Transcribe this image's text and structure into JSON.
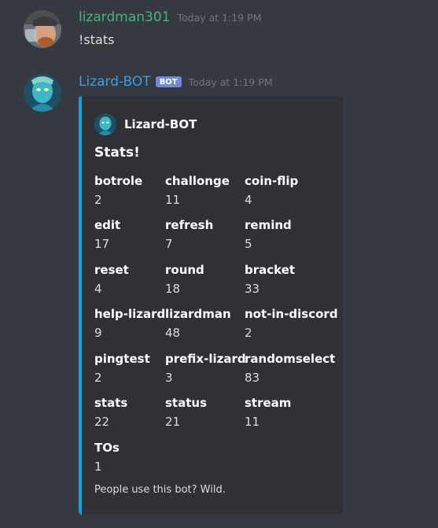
{
  "messages": [
    {
      "username": "lizardman301",
      "username_color": "#43b581",
      "timestamp": "Today at 1:19 PM",
      "content": "!stats",
      "avatar_icon": "user-avatar-photo"
    },
    {
      "username": "Lizard-BOT",
      "username_color": "#3d9be9",
      "bot_tag": "BOT",
      "timestamp": "Today at 1:19 PM",
      "avatar_icon": "bot-avatar-art"
    }
  ],
  "embed": {
    "accent_color": "#19a0d8",
    "author": "Lizard-BOT",
    "title": "Stats!",
    "fields": [
      {
        "name": "botrole",
        "value": "2"
      },
      {
        "name": "challonge",
        "value": "11"
      },
      {
        "name": "coin-flip",
        "value": "4"
      },
      {
        "name": "edit",
        "value": "17"
      },
      {
        "name": "refresh",
        "value": "7"
      },
      {
        "name": "remind",
        "value": "5"
      },
      {
        "name": "reset",
        "value": "4"
      },
      {
        "name": "round",
        "value": "18"
      },
      {
        "name": "bracket",
        "value": "33"
      },
      {
        "name": "help-lizard",
        "value": "9"
      },
      {
        "name": "lizardman",
        "value": "48"
      },
      {
        "name": "not-in-discord",
        "value": "2"
      },
      {
        "name": "pingtest",
        "value": "2"
      },
      {
        "name": "prefix-lizard",
        "value": "3"
      },
      {
        "name": "randomselect",
        "value": "83"
      },
      {
        "name": "stats",
        "value": "22"
      },
      {
        "name": "status",
        "value": "21"
      },
      {
        "name": "stream",
        "value": "11"
      },
      {
        "name": "TOs",
        "value": "1"
      }
    ],
    "footer": "People use this bot? Wild."
  }
}
